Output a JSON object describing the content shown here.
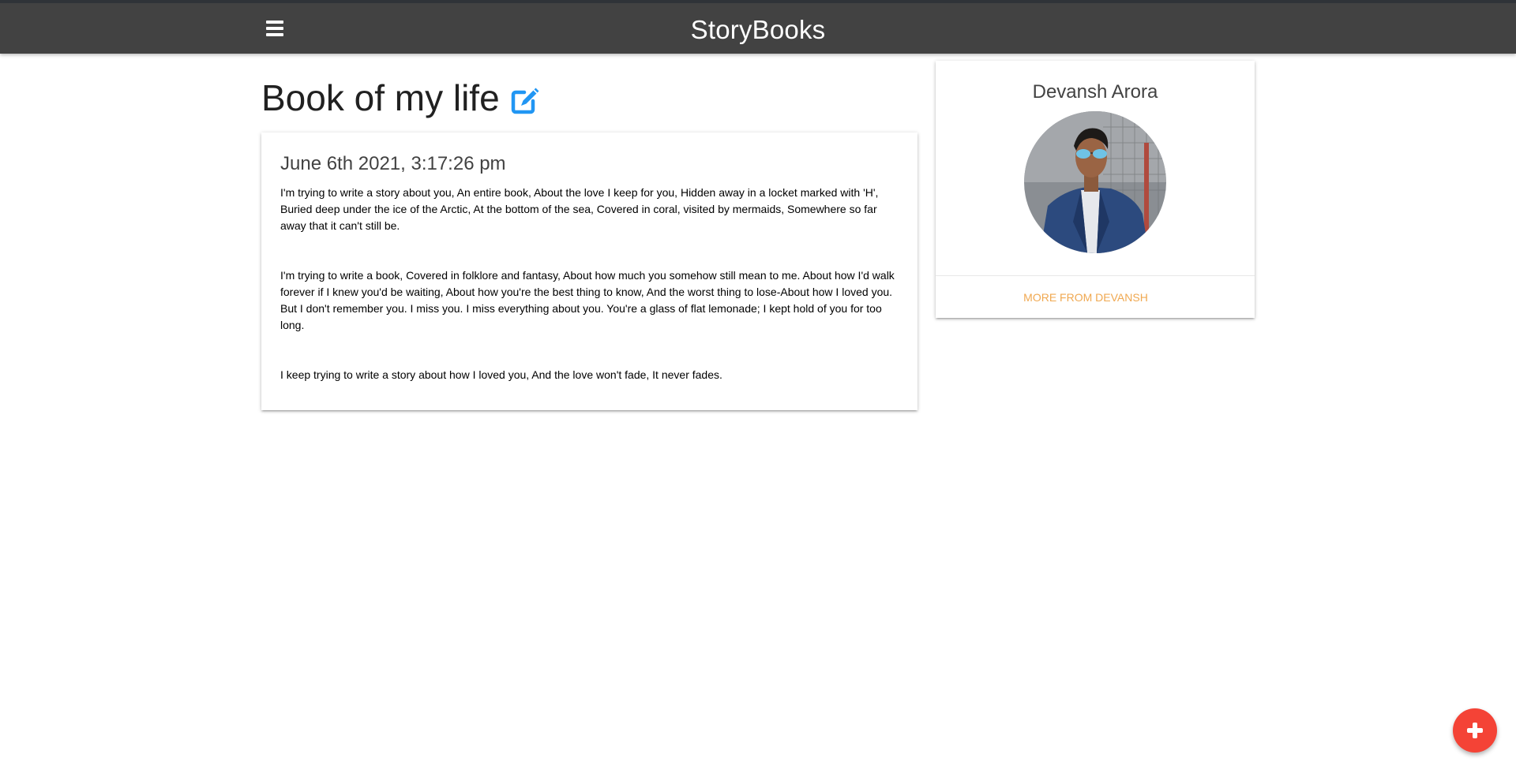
{
  "navbar": {
    "brand": "StoryBooks",
    "menu_icon": "hamburger-menu-icon"
  },
  "story": {
    "title": "Book of my life",
    "edit_icon": "edit-square-icon",
    "date": "June 6th 2021, 3:17:26 pm",
    "paragraphs": [
      "I'm trying to write a story about you, An entire book, About the love I keep for you, Hidden away in a locket marked with 'H', Buried deep under the ice of the Arctic, At the bottom of the sea, Covered in coral, visited by mermaids, Somewhere so far away that it can't still be.",
      "I'm trying to write a book, Covered in folklore and fantasy, About how much you somehow still mean to me. About how I'd walk forever if I knew you'd be waiting, About how you're the best thing to know, And the worst thing to lose-About how I loved you. But I don't remember you. I miss you. I miss everything about you. You're a glass of flat lemonade; I kept hold of you for too long.",
      "I keep trying to write a story about how I loved you, And the love won't fade, It never fades."
    ]
  },
  "author": {
    "name": "Devansh Arora",
    "more_link": "MORE FROM DEVANSH"
  },
  "fab": {
    "icon": "plus-icon"
  },
  "colors": {
    "navbar": "#424242",
    "edit_icon": "#2196f3",
    "more_link": "#f0a850",
    "fab": "#f44336"
  }
}
